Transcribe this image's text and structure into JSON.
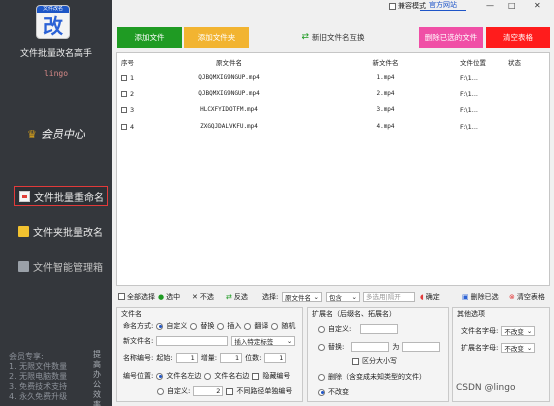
{
  "sidebar": {
    "logo_banner": "文件改名",
    "logo_char": "改",
    "title": "文件批量改名高手",
    "subtitle": "lingo",
    "member_label": "会员中心",
    "nav": [
      {
        "label": "文件批量重命名",
        "active": true
      },
      {
        "label": "文件夹批量改名",
        "active": false
      },
      {
        "label": "文件智能管理箱",
        "active": false
      }
    ],
    "footer_lines": [
      "会员专享:",
      "1. 无限文件数量",
      "2. 无限电脑数量",
      "3. 免费技术支持",
      "4. 永久免费升级"
    ],
    "footer_tag": "提高办公效率"
  },
  "topbar": {
    "compat_label": "兼容模式",
    "official_site": "官方网站",
    "min": "—",
    "max": "□",
    "close": "✕"
  },
  "toolbar": {
    "add_files": "添加文件",
    "add_folder": "添加文件夹",
    "import_new_names": "新旧文件名互换",
    "delete_selected": "删除已选的文件",
    "clear_table": "清空表格"
  },
  "table": {
    "headers": {
      "no": "序号",
      "orig": "原文件名",
      "new": "新文件名",
      "loc": "文件位置",
      "state": "状态"
    },
    "rows": [
      {
        "no": "1",
        "orig": "QJBQMXIG9NGUP.mp4",
        "new": "1.mp4",
        "loc": "F:\\1...",
        "state": ""
      },
      {
        "no": "2",
        "orig": "QJBQMXIG9NGUP.mp4",
        "new": "2.mp4",
        "loc": "F:\\1...",
        "state": ""
      },
      {
        "no": "3",
        "orig": "HLCXFYIDOTFM.mp4",
        "new": "3.mp4",
        "loc": "F:\\1...",
        "state": ""
      },
      {
        "no": "4",
        "orig": "ZXGQJDALVKFU.mp4",
        "new": "4.mp4",
        "loc": "F:\\1...",
        "state": ""
      }
    ]
  },
  "selbar": {
    "select_all": "全部选择",
    "select": "选中",
    "unselect": "不选",
    "invert": "反选",
    "choose_label": "选择:",
    "field": "原文件名",
    "op": "包含",
    "keyword_placeholder": "多选用|隔开",
    "confirm": "确定",
    "delete_selected": "删除已选",
    "clear_table": "清空表格"
  },
  "panel_name": {
    "title": "文件名",
    "mode_label": "命名方式:",
    "modes": [
      "自定义",
      "替换",
      "插入",
      "翻译",
      "随机"
    ],
    "newname_label": "新文件名:",
    "insert_option": "插入特定标签",
    "numbering_label": "名称编号:",
    "start_label": "起始:",
    "start_value": "1",
    "step_label": "增量:",
    "step_value": "1",
    "digits_label": "位数:",
    "digits_value": "1",
    "position_label": "编号位置:",
    "pos_left": "文件名左边",
    "pos_right": "文件名右边",
    "hide_number": "隐藏编号",
    "custom_label": "自定义:",
    "custom_value": "2",
    "cross_folder": "不同路径单独编号"
  },
  "panel_ext": {
    "title": "扩展名（后缀名、拓展名）",
    "custom": "自定义:",
    "replace": "替换:",
    "to": "为",
    "case": "区分大小写",
    "delete": "删除（含变成未知类型的文件）",
    "unchanged": "不改变"
  },
  "panel_other": {
    "title": "其他选项",
    "filename_case_label": "文件名字母:",
    "filename_case_value": "不改变",
    "ext_case_label": "扩展名字母:",
    "ext_case_value": "不改变"
  },
  "watermark": "CSDN @lingo"
}
